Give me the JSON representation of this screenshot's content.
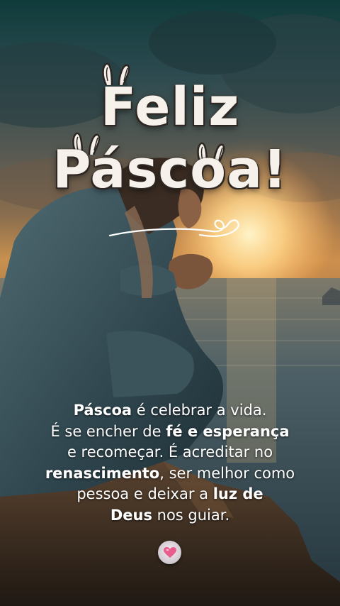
{
  "title": {
    "line1": "Feliz",
    "line2": "Páscoa!"
  },
  "message": {
    "l1_bold": "Páscoa",
    "l1_rest": " é celebrar a vida.",
    "l2_pre": "É se encher de ",
    "l2_bold": "fé e esperança",
    "l3": "e recomeçar. É acreditar no",
    "l4_bold": "renascimento",
    "l4_rest": ", ser melhor como",
    "l5_pre": "pessoa e deixar a ",
    "l5_bold": "luz de",
    "l6_bold": "Deus",
    "l6_rest": " nos guiar."
  },
  "icons": {
    "bunny_ears": "bunny-ears-icon",
    "heart_badge": "heart-icon",
    "flourish": "heart-flourish-icon"
  },
  "colors": {
    "title": "#f6f1ea",
    "title_outline": "#2d2622",
    "text": "#ffffff",
    "heart": "#e95c8e",
    "sun": "#ffc46e"
  }
}
